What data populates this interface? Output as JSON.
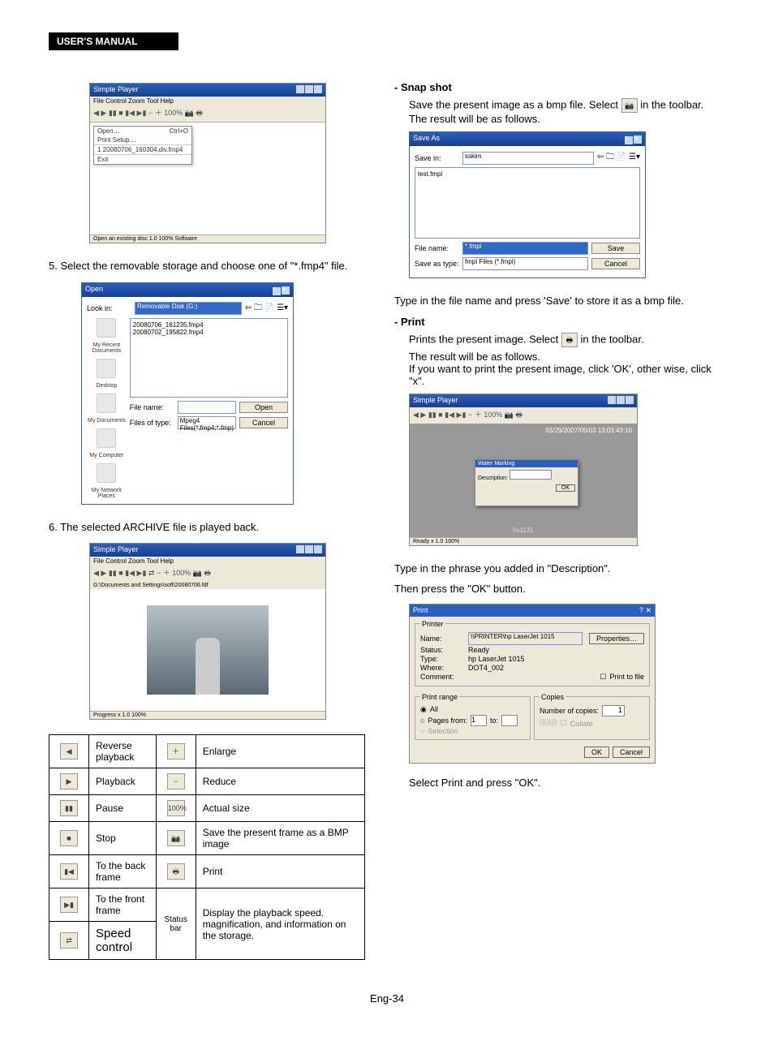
{
  "banner": "USER'S MANUAL",
  "left": {
    "player_title": "Simple Player",
    "menubar": "File  Control  Zoom  Tool  Help",
    "popup": {
      "open": "Open…",
      "open_key": "Ctrl+O",
      "print": "Print Setup…",
      "recent": "1 20080706_160304,div.fmp4",
      "exit": "Exit"
    },
    "status1": "Open an existing disc 1.0  100%   Software",
    "step5": "5. Select the removable storage and choose one of \"*.fmp4\" file.",
    "open_dialog": {
      "title": "Open",
      "lookin_label": "Look in:",
      "lookin_value": "Removable Disk (G:)",
      "files": [
        "20080706_161235.fmp4",
        "20080702_195822.fmp4"
      ],
      "folders": [
        "My Recent Documents",
        "Desktop",
        "My Documents",
        "My Computer",
        "My Network Places"
      ],
      "filename_label": "File name:",
      "filename_value": "",
      "type_label": "Files of type:",
      "type_value": "Mpeg4 Files(*.fmp4;*.fmp)",
      "open_btn": "Open",
      "cancel_btn": "Cancel"
    },
    "step6": "6. The selected ARCHIVE file is played back.",
    "player2_path": "G:\\Documents and Settings\\soft\\20080706.fdf",
    "player2_status": "Progress       x 1.0  100%",
    "table": {
      "rows": [
        {
          "icon": "◀",
          "desc": "Reverse playback",
          "icon2": "＋",
          "desc2": "Enlarge"
        },
        {
          "icon": "▶",
          "desc": "Playback",
          "icon2": "−",
          "desc2": "Reduce"
        },
        {
          "icon": "▮▮",
          "desc": "Pause",
          "icon2": "100%",
          "desc2": "Actual size"
        },
        {
          "icon": "■",
          "desc": "Stop",
          "icon2": "📷",
          "desc2": "Save the present frame as a BMP image"
        },
        {
          "icon": "▮◀",
          "desc": "To the back frame",
          "icon2": "🖶",
          "desc2": "Print"
        },
        {
          "icon": "▶▮",
          "desc": "To the front frame",
          "icon2": "Status bar",
          "desc2": "Display the playback speed. magnification, and information on the storage."
        },
        {
          "icon": "⇄",
          "desc": "Speed control",
          "icon2": "",
          "desc2": ""
        }
      ]
    }
  },
  "right": {
    "snapshot_heading": "- Snap shot",
    "snapshot_body1_a": "Save the present image as a bmp file. Select ",
    "snapshot_body1_b": " in the toolbar.",
    "snapshot_body2": "The result will be as follows.",
    "save_dialog": {
      "title": "Save As",
      "savein_label": "Save in:",
      "savein_value": "sskim",
      "file_listed": "test.fmpi",
      "filename_label": "File name:",
      "filename_value": "*.fmpi",
      "type_label": "Save as type:",
      "type_value": "fmpi Files (*.fmpi)",
      "save_btn": "Save",
      "cancel_btn": "Cancel"
    },
    "save_instr": "Type in the file name and press 'Save' to store it as a bmp file.",
    "print_heading": "- Print",
    "print_body1_a": "Prints the present image. Select ",
    "print_body1_b": " in the toolbar.",
    "print_body2": "The result will be as follows.",
    "print_body3": "If you want to print the present image, click 'OK', other wise, click \"x\".",
    "print_shot_title": "Simple Player",
    "print_shot_time": "03/29/2007/05/03    13:03:43:10",
    "prompt": {
      "title": "Water Marking",
      "field": "Description: ",
      "btn": "OK",
      "extra": "0x1131"
    },
    "print_instr1": "Type in the phrase you added in \"Description\".",
    "print_instr2": "Then press the \"OK\" button.",
    "print_dialog": {
      "title": "Print",
      "printer_legend": "Printer",
      "name_label": "Name:",
      "name_value": "\\\\PRINTER\\hp LaserJet 1015",
      "properties": "Properties…",
      "status_label": "Status:",
      "status_value": "Ready",
      "type_label": "Type:",
      "type_value": "hp LaserJet 1015",
      "where_label": "Where:",
      "where_value": "DOT4_002",
      "comment_label": "Comment:",
      "printtofile": "Print to file",
      "range_legend": "Print range",
      "range_all": "All",
      "range_pages": "Pages  from:",
      "range_pages_from": "1",
      "range_pages_to_lbl": "to:",
      "range_sel": "Selection",
      "copies_legend": "Copies",
      "copies_num_label": "Number of copies:",
      "copies_num_value": "1",
      "collate": "Collate",
      "ok": "OK",
      "cancel": "Cancel"
    },
    "select_print": "Select Print and press \"OK\"."
  },
  "footer": "Eng-34"
}
